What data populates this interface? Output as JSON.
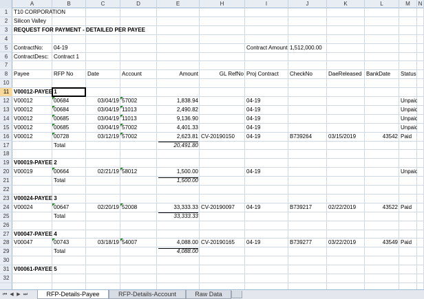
{
  "columns": [
    "A",
    "B",
    "C",
    "D",
    "E",
    "H",
    "I",
    "J",
    "K",
    "L",
    "M",
    "N"
  ],
  "rows": [
    "1",
    "2",
    "3",
    "4",
    "5",
    "6",
    "7",
    "8",
    "10",
    "11",
    "12",
    "13",
    "14",
    "15",
    "16",
    "17",
    "18",
    "19",
    "20",
    "21",
    "22",
    "23",
    "24",
    "25",
    "26",
    "27",
    "28",
    "29",
    "30",
    "31",
    "32"
  ],
  "header": {
    "company": "T10 CORPORATION",
    "location": "Silicon Valley",
    "report_title": "REQUEST FOR PAYMENT - DETAILED PER PAYEE",
    "contract_no_label": "ContractNo:",
    "contract_no": "04-19",
    "contract_desc_label": "ContractDesc:",
    "contract_desc": "Contract 1",
    "contract_amount_label": "Contract Amount",
    "contract_amount": "1,512,000.00"
  },
  "table_headers": [
    "Payee",
    "RFP No",
    "Date",
    "Account",
    "Amount",
    "GL RefNo",
    "Proj Contract",
    "CheckNo",
    "DaeReleased",
    "BankDate",
    "Status"
  ],
  "groups": [
    {
      "title": "V00012-PAYEE 1",
      "rows": [
        [
          "V00012",
          "00684",
          "03/04/19",
          "57002",
          "1,838.94",
          "",
          "04-19",
          "",
          "",
          "",
          "Unpaid"
        ],
        [
          "V00012",
          "00684",
          "03/04/19",
          "11013",
          "2,490.82",
          "",
          "04-19",
          "",
          "",
          "",
          "Unpaid"
        ],
        [
          "V00012",
          "00685",
          "03/04/19",
          "11013",
          "9,136.90",
          "",
          "04-19",
          "",
          "",
          "",
          "Unpaid"
        ],
        [
          "V00012",
          "00685",
          "03/04/19",
          "57002",
          "4,401.33",
          "",
          "04-19",
          "",
          "",
          "",
          "Unpaid"
        ],
        [
          "V00012",
          "00728",
          "03/12/19",
          "57002",
          "2,623.81",
          "CV-20190150",
          "04-19",
          "B739264",
          "03/15/2019",
          "43542",
          "Paid"
        ]
      ],
      "total_label": "Total",
      "total": "20,491.80"
    },
    {
      "title": "V00019-PAYEE 2",
      "rows": [
        [
          "V00019",
          "00664",
          "02/21/19",
          "58012",
          "1,500.00",
          "",
          "04-19",
          "",
          "",
          "",
          "Unpaid"
        ]
      ],
      "total_label": "Total",
      "total": "1,500.00"
    },
    {
      "title": "V00024-PAYEE 3",
      "rows": [
        [
          "V00024",
          "00647",
          "02/20/19",
          "52008",
          "33,333.33",
          "CV-20190097",
          "04-19",
          "B739217",
          "02/22/2019",
          "43522",
          "Paid"
        ]
      ],
      "total_label": "Total",
      "total": "33,333.33"
    },
    {
      "title": "V00047-PAYEE 4",
      "rows": [
        [
          "V00047",
          "00743",
          "03/18/19",
          "54007",
          "4,088.00",
          "CV-20190165",
          "04-19",
          "B739277",
          "03/22/2019",
          "43549",
          "Paid"
        ]
      ],
      "total_label": "Total",
      "total": "4,088.00"
    },
    {
      "title": "V00061-PAYEE 5",
      "rows": [],
      "total_label": "",
      "total": ""
    }
  ],
  "tabs": [
    "RFP-Details-Payee",
    "RFP-Details-Account",
    "Raw Data"
  ],
  "active_tab": 0,
  "colors": {
    "selected_row": "#f9d99a",
    "header_bg": "#e8edf4",
    "grid": "#d0d7e5",
    "error_marker": "#1a8a1a"
  }
}
